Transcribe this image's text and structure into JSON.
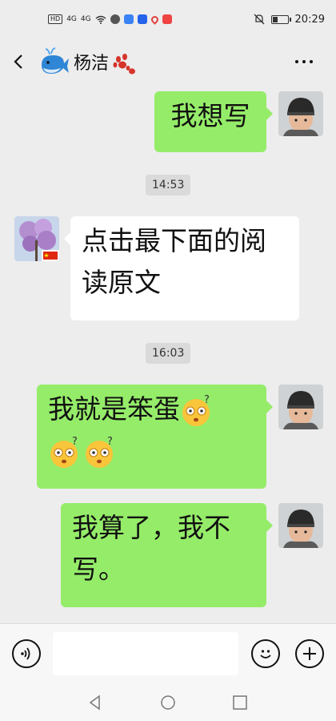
{
  "status_bar": {
    "left_chips": [
      "HD",
      "4G",
      "4G"
    ],
    "time": "20:29",
    "battery_level": 0.4
  },
  "header": {
    "title": "杨洁",
    "icons": [
      "whale-icon",
      "paw-icon"
    ]
  },
  "messages": [
    {
      "type": "sent",
      "text": "我想写"
    },
    {
      "type": "time",
      "text": "14:53"
    },
    {
      "type": "received",
      "line1": "点击最下面的阅",
      "line2": "读原文"
    },
    {
      "type": "time",
      "text": "16:03"
    },
    {
      "type": "sent",
      "text": "我就是笨蛋",
      "emoji": "dizzy-face-icon"
    },
    {
      "type": "sent",
      "line1": "我算了，我不",
      "line2": "写。"
    }
  ],
  "input_bar": {
    "placeholder": "",
    "icons": [
      "voice-icon",
      "emoji-icon",
      "plus-icon"
    ]
  },
  "colors": {
    "background": "#ededed",
    "sent_bubble": "#95ec69",
    "received_bubble": "#ffffff"
  }
}
